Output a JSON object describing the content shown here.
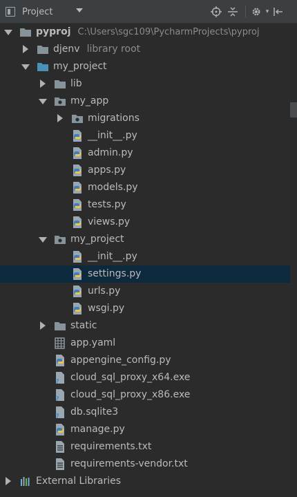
{
  "toolbar": {
    "view_label": "Project",
    "icons": [
      "project-view-icon",
      "dropdown-caret-icon",
      "locate-target-icon",
      "collapse-all-icon",
      "settings-gear-icon",
      "hide-panel-icon"
    ]
  },
  "tree": {
    "root": {
      "label": "pyproj",
      "path": "C:\\Users\\sgc109\\PycharmProjects\\pyproj"
    },
    "djenv": {
      "label": "djenv",
      "hint": "library root"
    },
    "my_project": {
      "label": "my_project"
    },
    "lib": {
      "label": "lib"
    },
    "my_app": {
      "label": "my_app"
    },
    "migrations": {
      "label": "migrations"
    },
    "app_files": [
      "__init__.py",
      "admin.py",
      "apps.py",
      "models.py",
      "tests.py",
      "views.py"
    ],
    "my_project_pkg": {
      "label": "my_project"
    },
    "pkg_files": [
      "__init__.py",
      "settings.py",
      "urls.py",
      "wsgi.py"
    ],
    "static": {
      "label": "static"
    },
    "app_yaml": "app.yaml",
    "appengine_config": "appengine_config.py",
    "proxy64": "cloud_sql_proxy_x64.exe",
    "proxy86": "cloud_sql_proxy_x86.exe",
    "db": "db.sqlite3",
    "manage": "manage.py",
    "req": "requirements.txt",
    "req_vendor": "requirements-vendor.txt",
    "external": "External Libraries",
    "selected": "settings.py"
  },
  "colors": {
    "background": "#2b2b2b",
    "toolbar": "#3c3f41",
    "selection": "#0d293e",
    "text": "#bbbbbb",
    "hint": "#8c8c8c",
    "folder": "#87939a",
    "module_folder": "#4a90b8",
    "python_blue": "#3f7fbf",
    "python_yellow": "#f0c542"
  }
}
